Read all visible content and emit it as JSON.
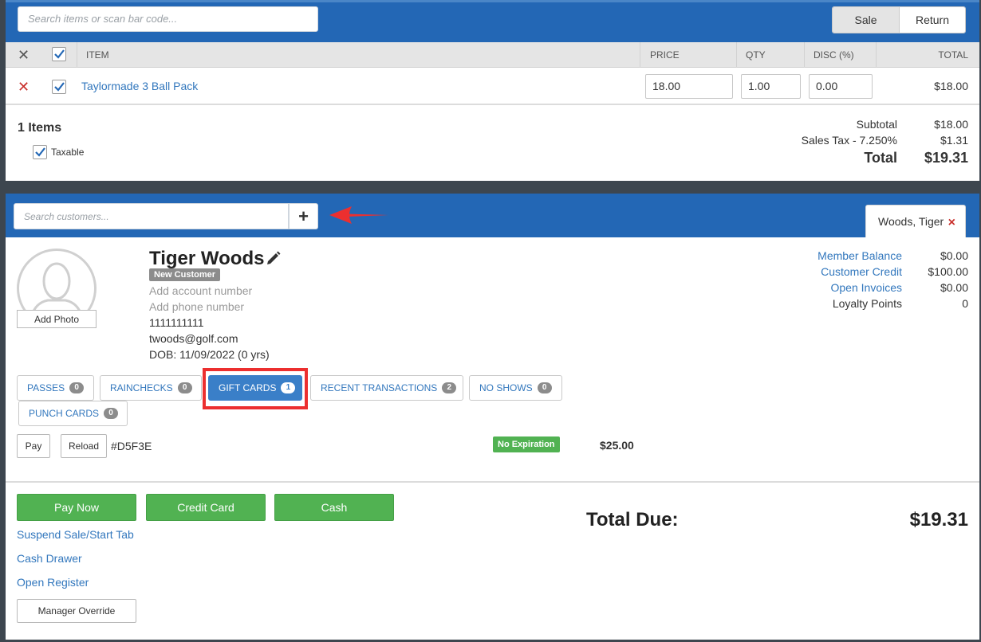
{
  "search": {
    "placeholder": "Search items or scan bar code..."
  },
  "mode": {
    "sale_label": "Sale",
    "return_label": "Return"
  },
  "cart": {
    "columns": {
      "item": "ITEM",
      "price": "PRICE",
      "qty": "QTY",
      "disc": "DISC (%)",
      "total": "TOTAL"
    },
    "rows": [
      {
        "name": "Taylormade 3 Ball Pack",
        "price": "18.00",
        "qty": "1.00",
        "disc": "0.00",
        "total": "$18.00"
      }
    ]
  },
  "summary": {
    "item_count": "1 Items",
    "taxable_label": "Taxable",
    "subtotal_label": "Subtotal",
    "subtotal_value": "$18.00",
    "tax_label": "Sales Tax - 7.250%",
    "tax_value": "$1.31",
    "total_label": "Total",
    "total_value": "$19.31"
  },
  "customer_search": {
    "placeholder": "Search customers...",
    "add_label": "+"
  },
  "customer_tab": {
    "label": "Woods, Tiger",
    "close": "×"
  },
  "customer": {
    "add_photo": "Add Photo",
    "name": "Tiger Woods",
    "badge": "New Customer",
    "account": "Add account number",
    "phone": "Add phone number",
    "number": "1111111111",
    "email": "twoods@golf.com",
    "dob": "DOB: 11/09/2022 (0 yrs)"
  },
  "balances": [
    {
      "label": "Member Balance",
      "value": "$0.00"
    },
    {
      "label": "Customer Credit",
      "value": "$100.00"
    },
    {
      "label": "Open Invoices",
      "value": "$0.00"
    },
    {
      "label": "Loyalty Points",
      "value": "0"
    }
  ],
  "tabs": [
    {
      "label": "PASSES",
      "count": "0"
    },
    {
      "label": "RAINCHECKS",
      "count": "0"
    },
    {
      "label": "GIFT CARDS",
      "count": "1"
    },
    {
      "label": "RECENT TRANSACTIONS",
      "count": "2"
    },
    {
      "label": "NO SHOWS",
      "count": "0"
    },
    {
      "label": "PUNCH CARDS",
      "count": "0"
    }
  ],
  "gift_card": {
    "pay_label": "Pay",
    "reload_label": "Reload",
    "code": "#D5F3E",
    "expiration": "No Expiration",
    "amount": "$25.00"
  },
  "actions": {
    "pay_now": "Pay Now",
    "credit_card": "Credit Card",
    "cash": "Cash",
    "suspend": "Suspend Sale/Start Tab",
    "cash_drawer": "Cash Drawer",
    "open_register": "Open Register",
    "manager_override": "Manager Override"
  },
  "total_due": {
    "label": "Total Due:",
    "value": "$19.31"
  },
  "colors": {
    "header_blue": "#2367b5",
    "link_blue": "#3277bd",
    "green": "#51b252",
    "red": "#c9302c"
  }
}
